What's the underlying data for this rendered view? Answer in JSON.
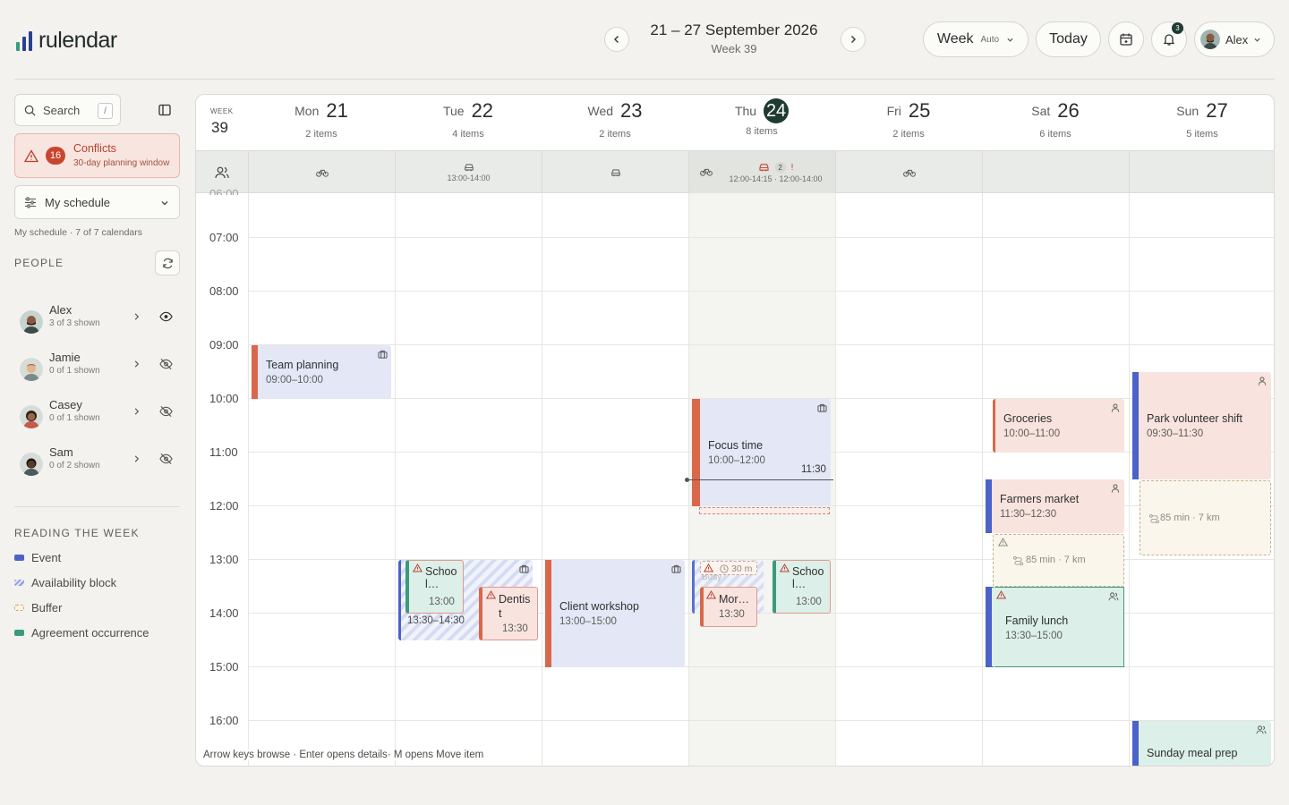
{
  "app": {
    "name": "rulendar"
  },
  "header": {
    "range_title": "21 – 27 September 2026",
    "week_label": "Week 39",
    "view_label": "Week",
    "view_mode": "Auto",
    "today_label": "Today",
    "notification_count": "3",
    "user_name": "Alex"
  },
  "sidebar": {
    "search_placeholder": "Search",
    "search_shortcut": "/",
    "conflicts": {
      "count": "16",
      "title": "Conflicts",
      "subtitle": "30-day planning window"
    },
    "schedule_select": "My schedule",
    "schedule_summary": "My schedule · 7 of 7 calendars",
    "people_heading": "PEOPLE",
    "people": [
      {
        "name": "Alex",
        "shown": "3 of 3 shown",
        "visible": true
      },
      {
        "name": "Jamie",
        "shown": "0 of 1 shown",
        "visible": false
      },
      {
        "name": "Casey",
        "shown": "0 of 1 shown",
        "visible": false
      },
      {
        "name": "Sam",
        "shown": "0 of 2 shown",
        "visible": false
      }
    ],
    "legend_heading": "READING THE WEEK",
    "legend": [
      {
        "label": "Event",
        "color": "#4a62c9"
      },
      {
        "label": "Availability block",
        "color": "#8d9bd9"
      },
      {
        "label": "Buffer",
        "color": "#e0a35a"
      },
      {
        "label": "Agreement occurrence",
        "color": "#3b9a7b"
      }
    ]
  },
  "calendar": {
    "week_small": "WEEK",
    "week_number": "39",
    "days": [
      {
        "dow": "Mon",
        "num": "21",
        "items": "2 items"
      },
      {
        "dow": "Tue",
        "num": "22",
        "items": "4 items"
      },
      {
        "dow": "Wed",
        "num": "23",
        "items": "2 items"
      },
      {
        "dow": "Thu",
        "num": "24",
        "items": "8 items",
        "today": true
      },
      {
        "dow": "Fri",
        "num": "25",
        "items": "2 items"
      },
      {
        "dow": "Sat",
        "num": "26",
        "items": "6 items"
      },
      {
        "dow": "Sun",
        "num": "27",
        "items": "5 items"
      }
    ],
    "strip": {
      "tue_time": "13:00-14:00",
      "thu_count": "2",
      "thu_flag": "!",
      "thu_time": "12:00-14:15 · 12:00-14:00"
    },
    "hours": [
      "07:00",
      "08:00",
      "09:00",
      "10:00",
      "11:00",
      "12:00",
      "13:00",
      "14:00",
      "15:00",
      "16:00"
    ],
    "now_label": "11:30",
    "events": {
      "team_planning": {
        "title": "Team planning",
        "time": "09:00–10:00"
      },
      "focus_time": {
        "title": "Focus time",
        "time": "10:00–12:00"
      },
      "client_workshop": {
        "title": "Client workshop",
        "time": "13:00–15:00"
      },
      "tue_school": {
        "title": "Schoo l…",
        "time": "13:00"
      },
      "tue_block_time": "13:30–14:30",
      "tue_dentist": {
        "title": "Dentis t",
        "time": "13:30"
      },
      "thu_buffer": "30 m",
      "thu_busy": "Busy",
      "thu_mor": {
        "title": "Mor…",
        "time": "13:30"
      },
      "thu_school": {
        "title": "Schoo l…",
        "time": "13:00"
      },
      "groceries": {
        "title": "Groceries",
        "time": "10:00–11:00"
      },
      "farmers_market": {
        "title": "Farmers market",
        "time": "11:30–12:30"
      },
      "sat_travel": "85 min · 7 km",
      "family_lunch": {
        "title": "Family lunch",
        "time": "13:30–15:00"
      },
      "park_shift": {
        "title": "Park volunteer shift",
        "time": "09:30–11:30"
      },
      "sun_travel": "85 min · 7 km",
      "meal_prep": {
        "title": "Sunday meal prep"
      }
    },
    "footer_hint": "Arrow keys browse · Enter opens details· M opens Move item"
  }
}
